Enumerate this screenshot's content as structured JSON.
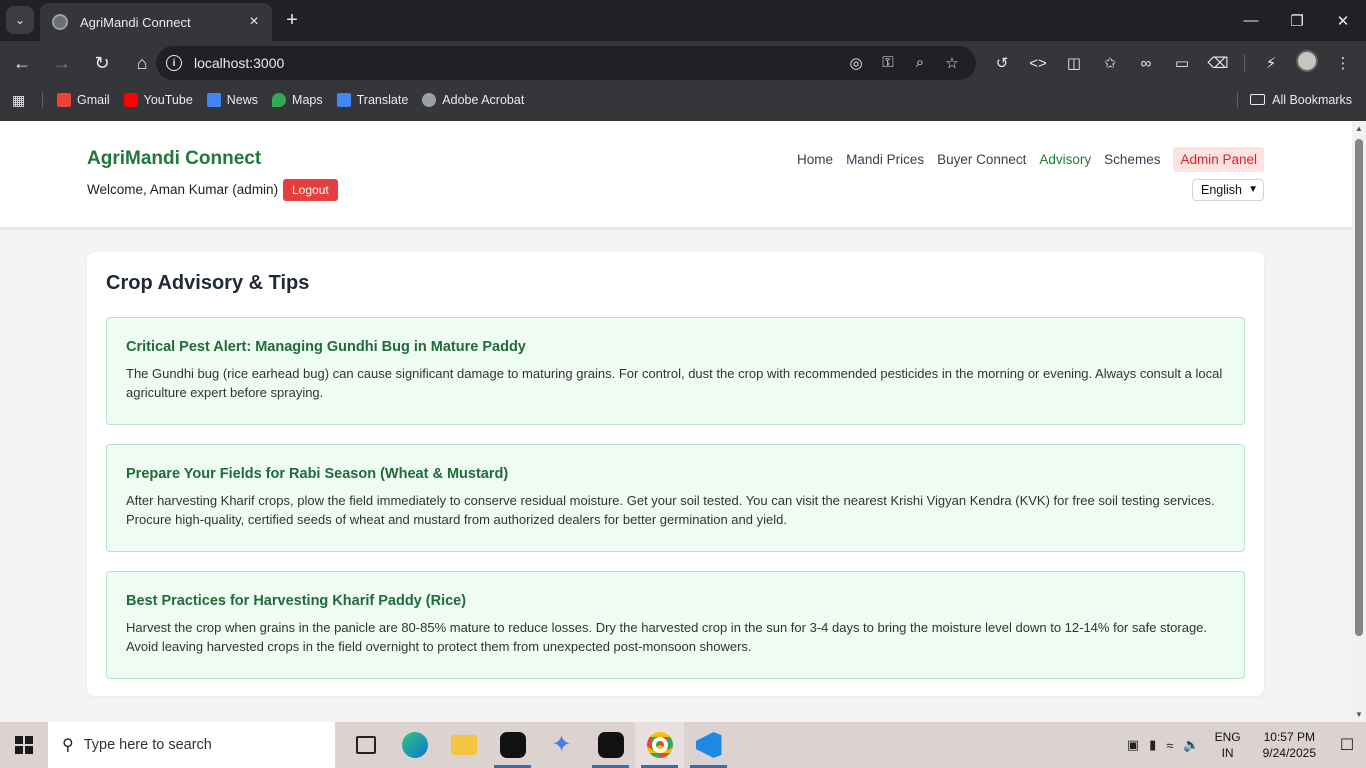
{
  "browser": {
    "tab_title": "AgriMandi Connect",
    "url": "localhost:3000",
    "bookmarks": [
      {
        "label": "Gmail",
        "color": "#ea4335"
      },
      {
        "label": "YouTube",
        "color": "#ff0000"
      },
      {
        "label": "News",
        "color": "#4285f4"
      },
      {
        "label": "Maps",
        "color": "#34a853"
      },
      {
        "label": "Translate",
        "color": "#4285f4"
      },
      {
        "label": "Adobe Acrobat",
        "color": "#9aa0a6"
      }
    ],
    "all_bookmarks": "All Bookmarks"
  },
  "header": {
    "brand": "AgriMandi Connect",
    "welcome": "Welcome, Aman Kumar (admin)",
    "logout": "Logout",
    "nav": [
      "Home",
      "Mandi Prices",
      "Buyer Connect",
      "Advisory",
      "Schemes",
      "Admin Panel"
    ],
    "language": "English"
  },
  "main": {
    "title": "Crop Advisory & Tips",
    "tips": [
      {
        "title": "Critical Pest Alert: Managing Gundhi Bug in Mature Paddy",
        "body": "The Gundhi bug (rice earhead bug) can cause significant damage to maturing grains. For control, dust the crop with recommended pesticides in the morning or evening. Always consult a local agriculture expert before spraying."
      },
      {
        "title": "Prepare Your Fields for Rabi Season (Wheat & Mustard)",
        "body": "After harvesting Kharif crops, plow the field immediately to conserve residual moisture. Get your soil tested. You can visit the nearest Krishi Vigyan Kendra (KVK) for free soil testing services. Procure high-quality, certified seeds of wheat and mustard from authorized dealers for better germination and yield."
      },
      {
        "title": "Best Practices for Harvesting Kharif Paddy (Rice)",
        "body": "Harvest the crop when grains in the panicle are 80-85% mature to reduce losses. Dry the harvested crop in the sun for 3-4 days to bring the moisture level down to 12-14% for safe storage. Avoid leaving harvested crops in the field overnight to protect them from unexpected post-monsoon showers."
      }
    ]
  },
  "taskbar": {
    "search_placeholder": "Type here to search",
    "lang_line1": "ENG",
    "lang_line2": "IN",
    "time": "10:57 PM",
    "date": "9/24/2025"
  },
  "colors": {
    "brand_green": "#1f7a3a",
    "logout_red": "#e53e3e",
    "tip_bg": "#effcf3"
  }
}
